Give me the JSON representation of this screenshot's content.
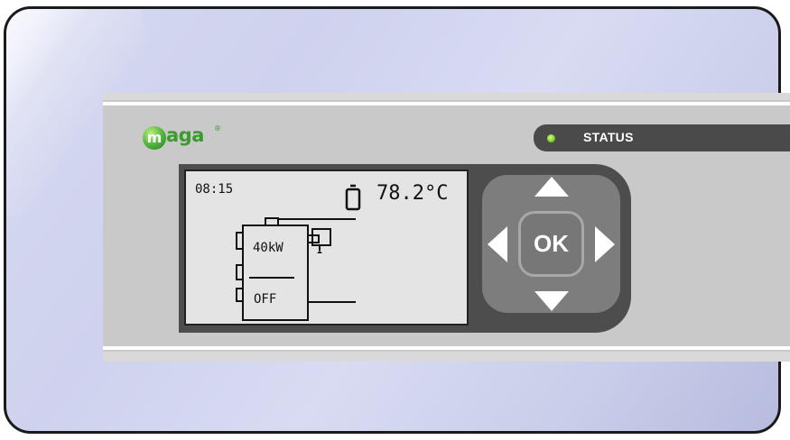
{
  "brand": {
    "logo_initial": "m",
    "logo_rest": "aga",
    "registered_mark": "®",
    "accent_color": "#3c9a2f"
  },
  "status": {
    "label": "STATUS",
    "led_color": "#7ccd26"
  },
  "display": {
    "time": "08:15",
    "temperature": "78.2°C",
    "power": "40kW",
    "state": "OFF"
  },
  "controls": {
    "ok_label": "OK",
    "arrows": [
      "up-arrow-icon",
      "down-arrow-icon",
      "left-arrow-icon",
      "right-arrow-icon"
    ]
  }
}
